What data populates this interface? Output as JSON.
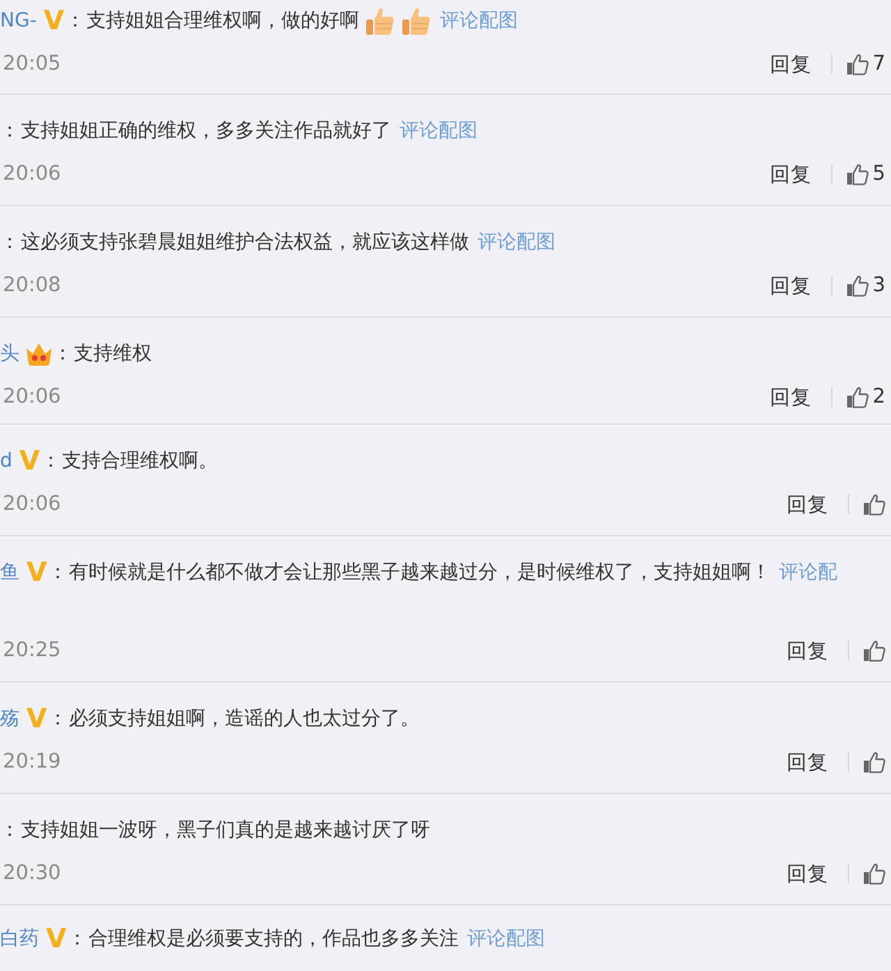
{
  "comments": [
    {
      "username": "NG-",
      "badge": {
        "kind": "verified",
        "text": "V"
      },
      "separator": "：",
      "text": "支持姐姐合理维权啊，做的好啊",
      "emojis": [
        {
          "kind": "thumbs-up"
        },
        {
          "kind": "thumbs-up"
        }
      ],
      "link": "评论配图",
      "time": "20:05",
      "reply": "回复",
      "likes": "7"
    },
    {
      "separator": "：",
      "text": "支持姐姐正确的维权，多多关注作品就好了",
      "link": "评论配图",
      "time": "20:06",
      "reply": "回复",
      "likes": "5"
    },
    {
      "separator": "：",
      "text": "这必须支持张碧晨姐姐维护合法权益，就应该这样做",
      "link": "评论配图",
      "time": "20:08",
      "reply": "回复",
      "likes": "3"
    },
    {
      "username": "头",
      "badge": {
        "kind": "crown"
      },
      "separator": "：",
      "text": "支持维权",
      "time": "20:06",
      "reply": "回复",
      "likes": "2"
    },
    {
      "username": "d",
      "badge": {
        "kind": "verified",
        "text": "V"
      },
      "separator": "：",
      "text": "支持合理维权啊。",
      "time": "20:06",
      "reply": "回复"
    },
    {
      "username": "鱼",
      "badge": {
        "kind": "verified",
        "text": "V"
      },
      "separator": "：",
      "text": "有时候就是什么都不做才会让那些黑子越来越过分，是时候维权了，支持姐姐啊！",
      "link": "评论配",
      "time": "20:25",
      "reply": "回复"
    },
    {
      "username": "殇",
      "badge": {
        "kind": "verified",
        "text": "V"
      },
      "separator": "：",
      "text": "必须支持姐姐啊，造谣的人也太过分了。",
      "time": "20:19",
      "reply": "回复"
    },
    {
      "separator": "：",
      "text": "支持姐姐一波呀，黑子们真的是越来越讨厌了呀",
      "time": "20:30",
      "reply": "回复"
    },
    {
      "username": "白药",
      "badge": {
        "kind": "verified",
        "text": "V"
      },
      "separator": "：",
      "text": "合理维权是必须要支持的，作品也多多关注",
      "link": "评论配图"
    }
  ]
}
